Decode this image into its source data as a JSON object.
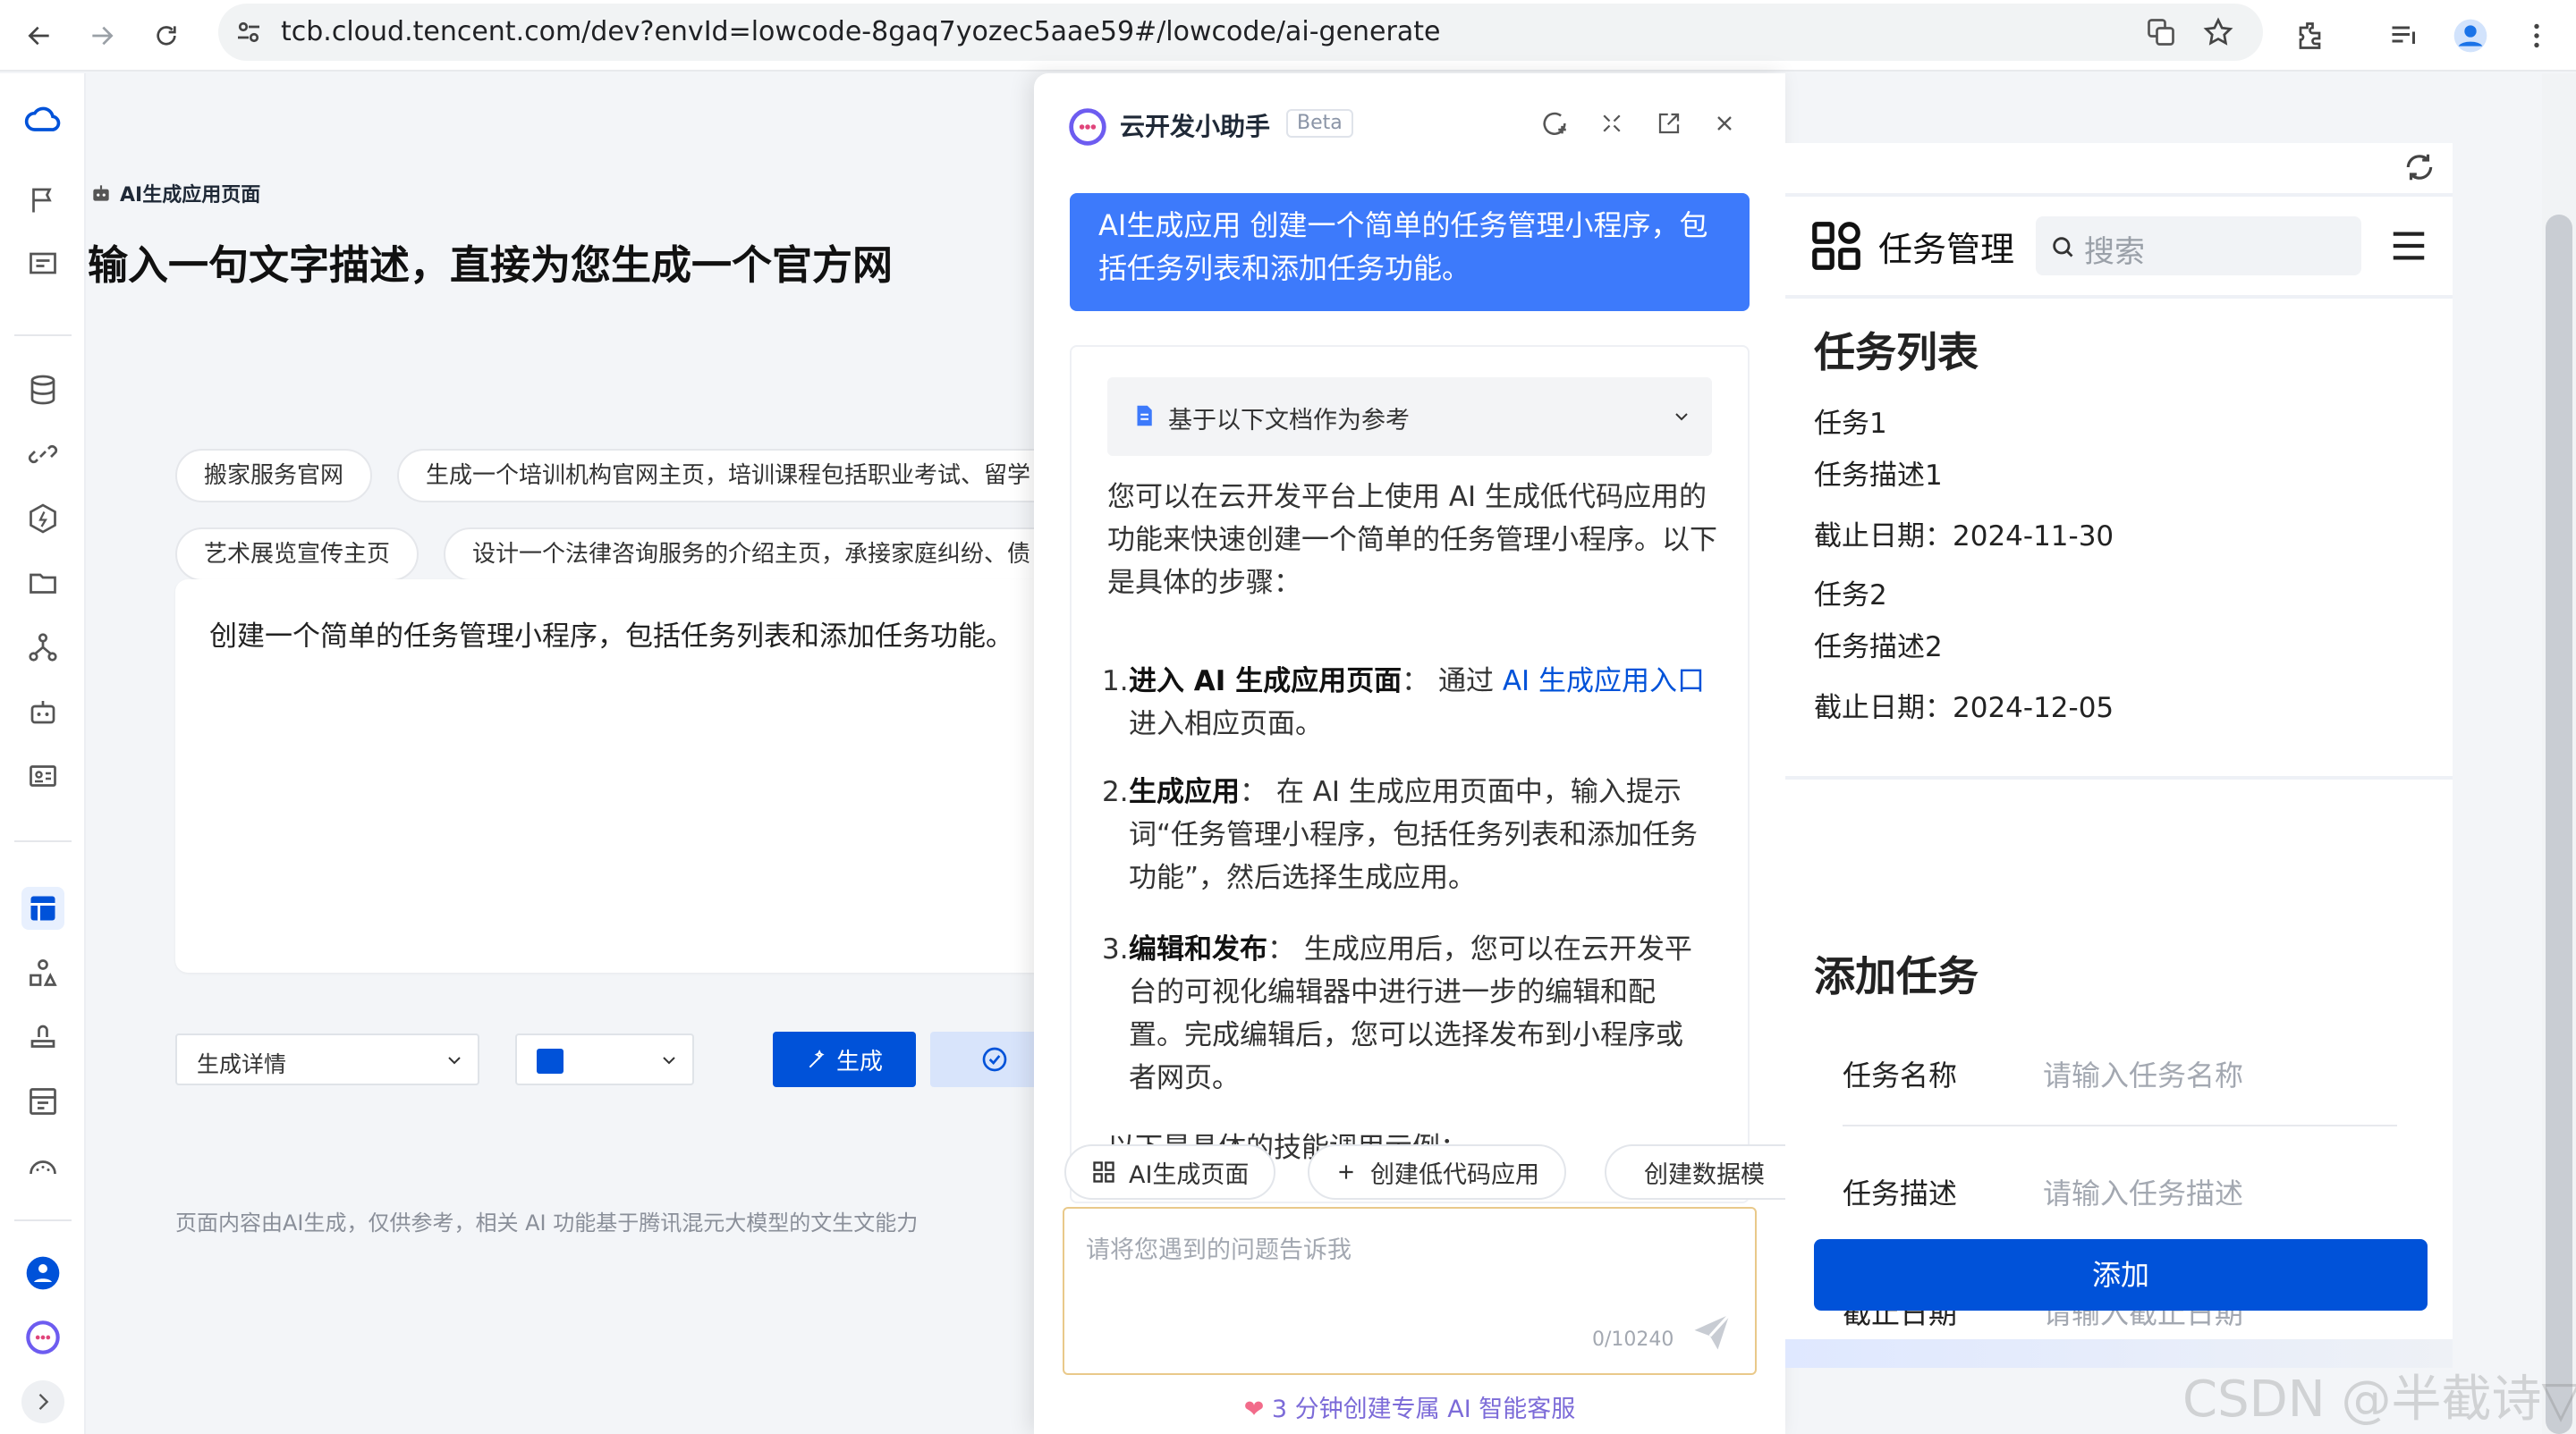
{
  "browser": {
    "url": "tcb.cloud.tencent.com/dev?envId=lowcode-8gaq7yozec5aae59#/lowcode/ai-generate"
  },
  "main": {
    "breadcrumb": "AI生成应用页面",
    "heading": "输入一句文字描述，直接为您生成一个官方网",
    "chips": [
      "搬家服务官网",
      "生成一个培训机构官网主页，培训课程包括职业考试、留学",
      "艺术展览宣传主页",
      "设计一个法律咨询服务的介绍主页，承接家庭纠纷、债"
    ],
    "prompt": "创建一个简单的任务管理小程序，包括任务列表和添加任务功能。",
    "select_mode": "生成详情",
    "generate_label": "生成",
    "footer": "页面内容由AI生成，仅供参考，相关 AI 功能基于腾讯混元大模型的文生文能力"
  },
  "assistant": {
    "title": "云开发小助手",
    "badge": "Beta",
    "user_message": "AI生成应用 创建一个简单的任务管理小程序，包括任务列表和添加任务功能。",
    "reference": "基于以下文档作为参考",
    "intro": "您可以在云开发平台上使用 AI 生成低代码应用的功能来快速创建一个简单的任务管理小程序。以下是具体的步骤：",
    "step1_num": "1.",
    "step1_title": "进入 AI 生成应用页面",
    "step1_mid": "： 通过 ",
    "step1_link": "AI 生成应用入口",
    "step1_end": " 进入相应页面。",
    "step2_num": "2.",
    "step2_title": "生成应用",
    "step2_body": "： 在 AI 生成应用页面中，输入提示词“任务管理小程序，包括任务列表和添加任务功能”，然后选择生成应用。",
    "step3_num": "3.",
    "step3_title": "编辑和发布",
    "step3_body": "： 生成应用后，您可以在云开发平台的可视化编辑器中进行进一步的编辑和配置。完成编辑后，您可以选择发布到小程序或者网页。",
    "trailing": "以下是具体的技能调用示例：",
    "quick_actions": [
      "AI生成页面",
      "创建低代码应用",
      "创建数据模"
    ],
    "input_placeholder": "请将您遇到的问题告诉我",
    "counter": "0/10240",
    "promo": "3 分钟创建专属 AI 智能客服"
  },
  "preview": {
    "app_title": "任务管理",
    "search_placeholder": "搜索",
    "list_heading": "任务列表",
    "tasks": [
      {
        "name": "任务1",
        "desc": "任务描述1",
        "due": "截止日期：2024-11-30"
      },
      {
        "name": "任务2",
        "desc": "任务描述2",
        "due": "截止日期：2024-12-05"
      }
    ],
    "add_heading": "添加任务",
    "fields": [
      {
        "label": "任务名称",
        "placeholder": "请输入任务名称"
      },
      {
        "label": "任务描述",
        "placeholder": "请输入任务描述"
      },
      {
        "label": "截止日期",
        "placeholder": "请输入截止日期"
      }
    ],
    "add_button": "添加"
  },
  "watermark": "CSDN @半截诗▽",
  "colors": {
    "primary": "#0052d9",
    "user_bubble": "#3d7afb",
    "link": "#0052d9",
    "promo": "#7c6bd8"
  }
}
